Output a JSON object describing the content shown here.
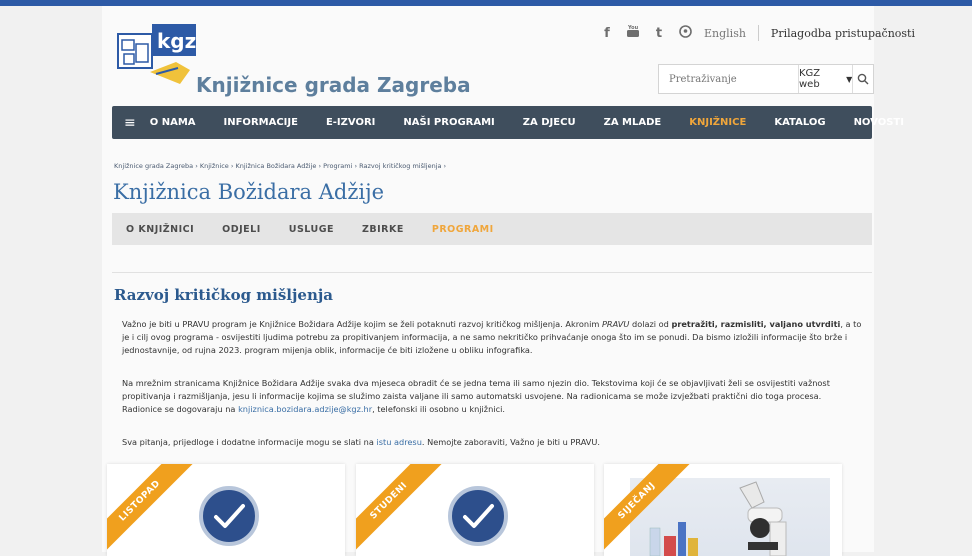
{
  "header": {
    "brand": "Knjižnice grada Zagreba",
    "logo_text": "kgz",
    "social_icons": [
      {
        "name": "facebook-icon",
        "glyph": "f"
      },
      {
        "name": "youtube-icon",
        "glyph": "▶"
      },
      {
        "name": "tumblr-icon",
        "glyph": "t"
      },
      {
        "name": "pinterest-icon",
        "glyph": "℗"
      }
    ],
    "language": "English",
    "accessibility": "Prilagodba pristupačnosti"
  },
  "search": {
    "placeholder": "Pretraživanje",
    "scope": "KGZ web",
    "button_icon": "search-icon"
  },
  "nav": {
    "items": [
      {
        "label": "O NAMA",
        "active": false
      },
      {
        "label": "INFORMACIJE",
        "active": false
      },
      {
        "label": "E-IZVORI",
        "active": false
      },
      {
        "label": "NAŠI PROGRAMI",
        "active": false
      },
      {
        "label": "ZA DJECU",
        "active": false
      },
      {
        "label": "ZA MLADE",
        "active": false
      },
      {
        "label": "KNJIŽNICE",
        "active": true
      },
      {
        "label": "KATALOG",
        "active": false
      },
      {
        "label": "NOVOSTI",
        "active": false
      }
    ]
  },
  "breadcrumb": "Knjižnice grada Zagreba › Knjižnice › Knjižnica Božidara Adžije › Programi › Razvoj kritičkog mišljenja ›",
  "page_title": "Knjižnica Božidara Adžije",
  "subnav": {
    "items": [
      {
        "label": "O KNJIŽNICI",
        "active": false
      },
      {
        "label": "ODJELI",
        "active": false
      },
      {
        "label": "USLUGE",
        "active": false
      },
      {
        "label": "ZBIRKE",
        "active": false
      },
      {
        "label": "PROGRAMI",
        "active": true
      }
    ]
  },
  "article": {
    "title": "Razvoj kritičkog mišljenja",
    "p1_a": "Važno je biti u PRAVU program je Knjižnice Božidara Adžije kojim se želi potaknuti razvoj kritičkog mišljenja. Akronim ",
    "p1_em": "PRAVU",
    "p1_b": " dolazi od ",
    "p1_bold": "pretražiti, razmisliti, valjano utvrditi",
    "p1_c": ", a to je i cilj ovog programa - osvijestiti ljudima potrebu za propitivanjem informacija, a ne samo nekritičko prihvaćanje onoga što im se ponudi. Da bismo izložili informacije što brže i jednostavnije, od rujna 2023. program mijenja oblik, informacije će biti izložene u obliku infografika.",
    "p2_a": "Na mrežnim stranicama Knjižnice Božidara Adžije svaka dva mjeseca obradit će se jedna tema ili samo njezin dio. Tekstovima koji će se objavljivati želi se osvijestiti važnost propitivanja i razmišljanja, jesu li informacije kojima se služimo zaista valjane ili samo automatski usvojene. Na radionicama se može izvježbati praktični dio toga procesa. Radionice se dogovaraju na ",
    "p2_link": "knjiznica.bozidara.adzije@kgz.hr",
    "p2_b": ", telefonski ili osobno u knjižnici.",
    "p3_a": "Sva pitanja, prijedloge i dodatne informacije mogu se slati na ",
    "p3_link": "istu adresu",
    "p3_b": ". Nemojte zaboraviti, Važno je biti u PRAVU."
  },
  "cards": [
    {
      "ribbon": "LISTOPAD",
      "image": "checkmark"
    },
    {
      "ribbon": "STUDENI",
      "image": "checkmark"
    },
    {
      "ribbon": "SIJEČANJ",
      "image": "microscope"
    }
  ],
  "colors": {
    "accent": "#f0a63b",
    "nav_bg": "#3f4e5d",
    "title_blue": "#3a6ea5",
    "ribbon": "#f0a01e",
    "check_blue": "#2d4f8c"
  }
}
